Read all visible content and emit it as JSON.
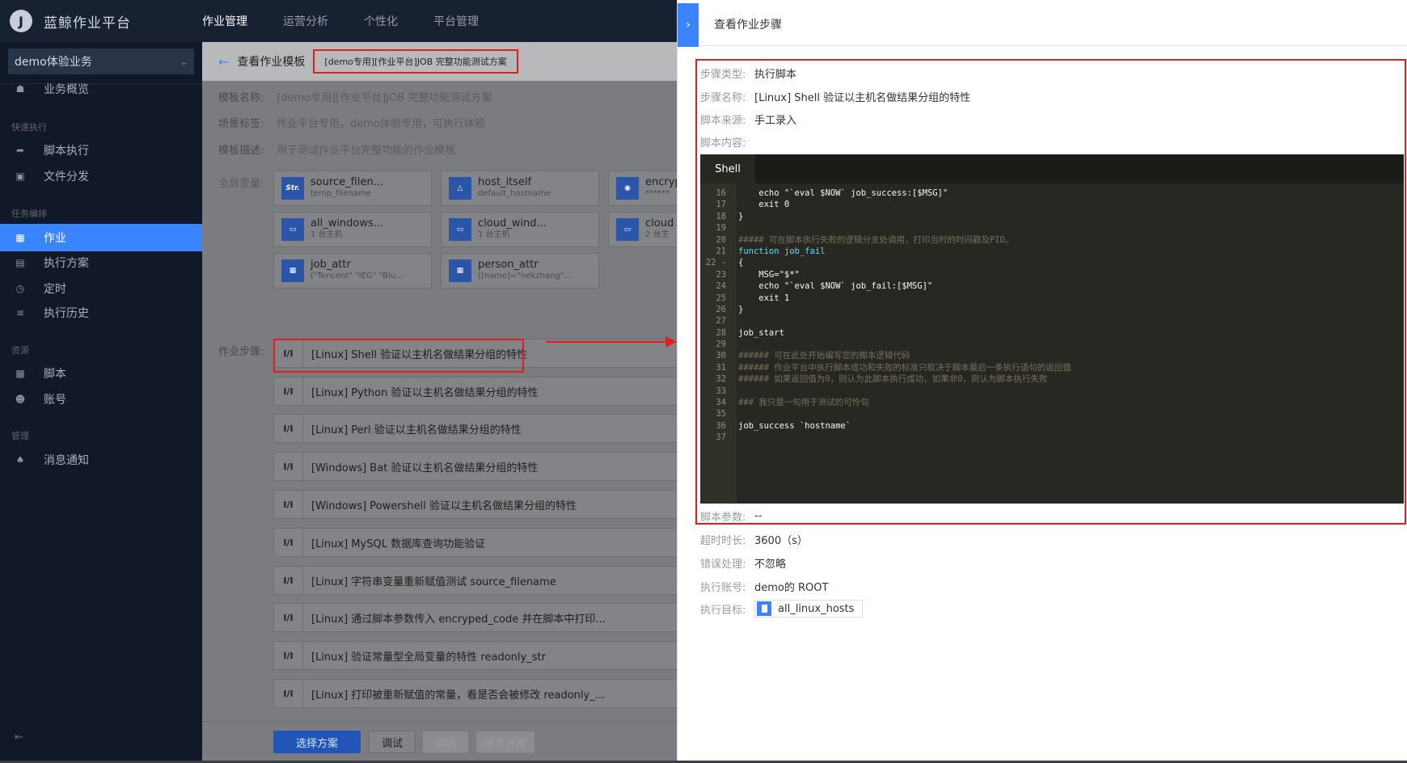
{
  "app": {
    "logo_letter": "J",
    "title": "蓝鲸作业平台"
  },
  "topnav": [
    "作业管理",
    "运营分析",
    "个性化",
    "平台管理"
  ],
  "sidebar": {
    "business": "demo体验业务",
    "overview": "业务概览",
    "groups": {
      "quick": "快速执行",
      "task": "任务编排",
      "resource": "资源",
      "manage": "管理"
    },
    "items": [
      "脚本执行",
      "文件分发",
      "作业",
      "执行方案",
      "定时",
      "执行历史",
      "脚本",
      "账号",
      "消息通知"
    ]
  },
  "main": {
    "header_title": "查看作业模板",
    "header_sub": "[demo专用][作业平台]JOB 完整功能测试方案",
    "name_label": "模板名称:",
    "name_value": "[demo专用][作业平台]JOB 完整功能测试方案",
    "tags_label": "场景标签:",
    "tags_value": "作业平台专用，demo体验专用，可执行体验",
    "desc_label": "模板描述:",
    "desc_value": "用于测试作业平台完整功能的作业模板",
    "vars_label": "全局变量:",
    "variables": [
      {
        "icon": "Str.",
        "name": "source_filen...",
        "value": "temp_filename"
      },
      {
        "icon": "host",
        "name": "host_itself",
        "value": "default_hostname"
      },
      {
        "icon": "lock",
        "name": "encryp",
        "value": "******"
      },
      {
        "icon": "list",
        "name": "all_windows...",
        "value": "1 台主机"
      },
      {
        "icon": "list",
        "name": "cloud_wind...",
        "value": "1 台主机"
      },
      {
        "icon": "list",
        "name": "cloud",
        "value": "2 台主"
      },
      {
        "icon": "grid",
        "name": "job_attr",
        "value": "(\"Tencent\" \"IEG\" \"Blu..."
      },
      {
        "icon": "grid",
        "name": "person_attr",
        "value": "([name]=\"nekzhang\"..."
      }
    ],
    "steps_label": "作业步骤:",
    "steps": [
      "[Linux] Shell 验证以主机名做结果分组的特性",
      "[Linux] Python 验证以主机名做结果分组的特性",
      "[Linux] Perl 验证以主机名做结果分组的特性",
      "[Windows] Bat 验证以主机名做结果分组的特性",
      "[Windows] Powershell 验证以主机名做结果分组的特性",
      "[Linux] MySQL 数据库查询功能验证",
      "[Linux] 字符串变量重新赋值测试 source_filename",
      "[Linux] 通过脚本参数传入 encryped_code 并在脚本中打印...",
      "[Linux] 验证常量型全局变量的特性 readonly_str",
      "[Linux] 打印被重新赋值的常量，看是否会被修改 readonly_..."
    ],
    "step_type": "I/I",
    "buttons": {
      "select": "选择方案",
      "debug": "调试",
      "edit": "编辑",
      "sync": "同步方案"
    }
  },
  "panel": {
    "title": "查看作业步骤",
    "step_type_label": "步骤类型:",
    "step_type_value": "执行脚本",
    "step_name_label": "步骤名称:",
    "step_name_value": "[Linux] Shell 验证以主机名做结果分组的特性",
    "script_source_label": "脚本来源:",
    "script_source_value": "手工录入",
    "script_content_label": "脚本内容:",
    "editor_tab": "Shell",
    "code_lines": [
      {
        "n": "16",
        "t": "    echo \"`eval $NOW` job_success:[$MSG]\""
      },
      {
        "n": "17",
        "t": "    exit 0"
      },
      {
        "n": "18",
        "t": "}"
      },
      {
        "n": "19",
        "t": ""
      },
      {
        "n": "20",
        "t": "##### 可在脚本执行失败的逻辑分支处调用，打印当时的时间戳及PID。"
      },
      {
        "n": "21",
        "t": "function job_fail"
      },
      {
        "n": "22 -",
        "t": "{"
      },
      {
        "n": "23",
        "t": "    MSG=\"$*\""
      },
      {
        "n": "24",
        "t": "    echo \"`eval $NOW` job_fail:[$MSG]\""
      },
      {
        "n": "25",
        "t": "    exit 1"
      },
      {
        "n": "26",
        "t": "}"
      },
      {
        "n": "27",
        "t": ""
      },
      {
        "n": "28",
        "t": "job_start"
      },
      {
        "n": "29",
        "t": ""
      },
      {
        "n": "30",
        "t": "###### 可在此处开始编写您的脚本逻辑代码"
      },
      {
        "n": "31",
        "t": "###### 作业平台中执行脚本成功和失败的标准只取决于脚本最后一条执行语句的返回值"
      },
      {
        "n": "32",
        "t": "###### 如果返回值为0，则认为此脚本执行成功，如果非0，则认为脚本执行失败"
      },
      {
        "n": "33",
        "t": ""
      },
      {
        "n": "34",
        "t": "### 我只是一句用于测试的可怜句"
      },
      {
        "n": "35",
        "t": ""
      },
      {
        "n": "36",
        "t": "job_success `hostname`"
      },
      {
        "n": "37",
        "t": ""
      }
    ],
    "script_params_label": "脚本参数:",
    "script_params_value": "--",
    "timeout_label": "超时时长:",
    "timeout_value": "3600（s）",
    "error_label": "错误处理:",
    "error_value": "不忽略",
    "account_label": "执行账号:",
    "account_value": "demo的 ROOT",
    "target_label": "执行目标:",
    "target_value": "all_linux_hosts"
  }
}
